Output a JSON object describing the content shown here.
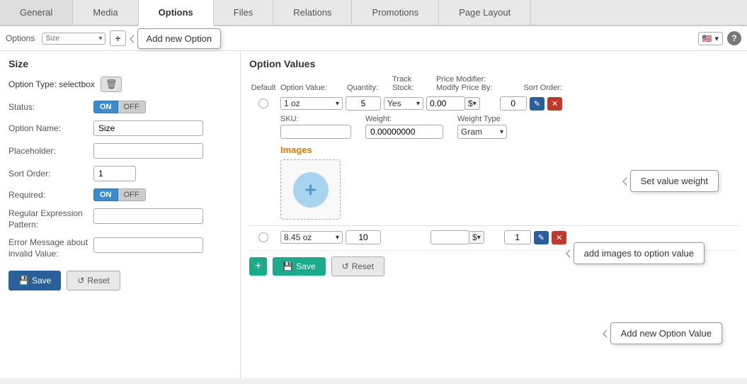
{
  "tabs": [
    {
      "label": "General",
      "active": false
    },
    {
      "label": "Media",
      "active": false
    },
    {
      "label": "Options",
      "active": true
    },
    {
      "label": "Files",
      "active": false
    },
    {
      "label": "Relations",
      "active": false
    },
    {
      "label": "Promotions",
      "active": false
    },
    {
      "label": "Page Layout",
      "active": false
    }
  ],
  "options_bar": {
    "label": "Options",
    "select_value": "Size",
    "add_btn_label": "+",
    "callout_add_option": "Add new Option",
    "flag": "🇺🇸",
    "help": "?"
  },
  "left_panel": {
    "section_title": "Size",
    "option_type_label": "Option Type: selectbox",
    "status_label": "Status:",
    "toggle_on": "ON",
    "toggle_off": "OFF",
    "option_name_label": "Option Name:",
    "option_name_value": "Size",
    "placeholder_label": "Placeholder:",
    "placeholder_value": "",
    "sort_order_label": "Sort Order:",
    "sort_order_value": "1",
    "required_label": "Required:",
    "req_toggle_on": "ON",
    "req_toggle_off": "OFF",
    "regex_label": "Regular Expression Pattern:",
    "regex_value": "",
    "error_msg_label": "Error Message about invalid Value:",
    "error_msg_value": "",
    "save_btn": "Save",
    "reset_btn": "Reset"
  },
  "right_panel": {
    "section_title": "Option Values",
    "headers": {
      "default": "Default",
      "option_value": "Option Value:",
      "quantity": "Quantity:",
      "track_stock": "Track Stock:",
      "price_modifier": "Price Modifier:",
      "modify_price_by": "Modify Price By:",
      "sort_order": "Sort Order:"
    },
    "row1": {
      "value": "1 oz",
      "quantity": "5",
      "track_stock": "Yes",
      "price_modifier": "0.00",
      "price_symbol": "$",
      "sort_order": "0",
      "sku": "",
      "weight": "0.00000000",
      "weight_type": "Gram"
    },
    "row2": {
      "value": "8.45 oz",
      "quantity": "10",
      "track_stock": "",
      "price_modifier": "",
      "price_symbol": "$",
      "sort_order": "1"
    },
    "images_title": "Images",
    "callout_set_weight": "Set value weight",
    "callout_add_images": "add images to option value",
    "callout_add_ov": "Add new Option Value",
    "save_btn": "Save",
    "reset_btn": "Reset",
    "add_btn_icon": "+"
  }
}
